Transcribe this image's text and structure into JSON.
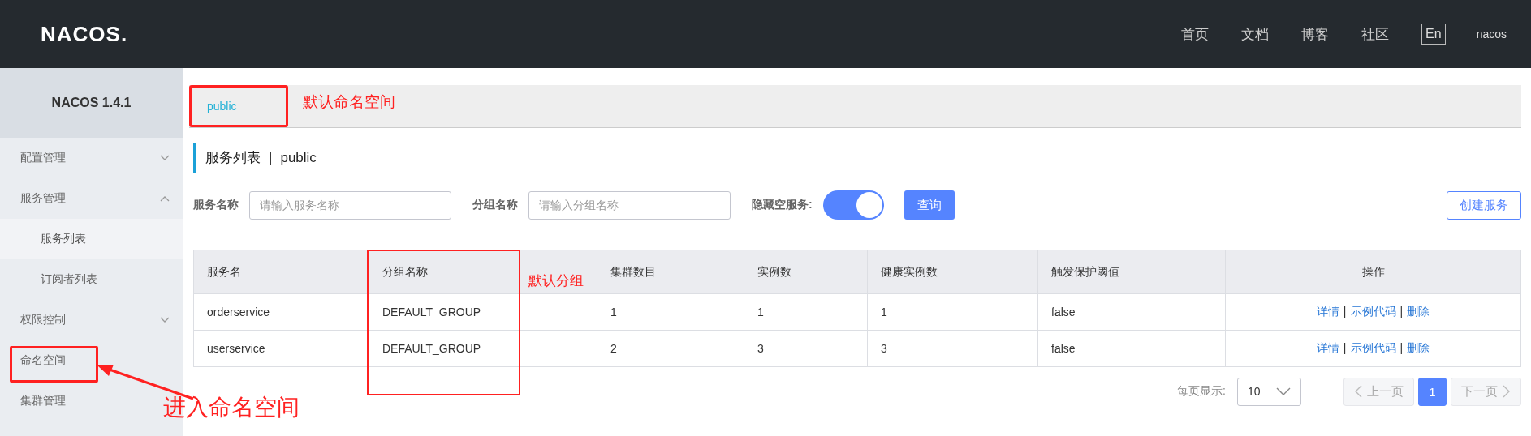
{
  "header": {
    "logo": "NACOS.",
    "nav": [
      "首页",
      "文档",
      "博客",
      "社区"
    ],
    "language": "En",
    "user": "nacos"
  },
  "sidebar": {
    "title": "NACOS 1.4.1",
    "items": [
      {
        "label": "配置管理",
        "kind": "group",
        "expanded": false,
        "selected": false,
        "highlighted": false
      },
      {
        "label": "服务管理",
        "kind": "group",
        "expanded": true,
        "selected": false,
        "highlighted": false,
        "children": [
          {
            "label": "服务列表",
            "selected": true
          },
          {
            "label": "订阅者列表",
            "selected": false
          }
        ]
      },
      {
        "label": "权限控制",
        "kind": "group",
        "expanded": false,
        "selected": false,
        "highlighted": false
      },
      {
        "label": "命名空间",
        "kind": "link",
        "selected": false,
        "highlighted": true
      },
      {
        "label": "集群管理",
        "kind": "link",
        "selected": false,
        "highlighted": false
      }
    ]
  },
  "namespaces": [
    {
      "label": "public",
      "selected": true,
      "highlighted": true
    }
  ],
  "page_title": {
    "title": "服务列表",
    "separator": "|",
    "namespace": "public"
  },
  "filters": [
    {
      "kind": "text",
      "label": "服务名称",
      "placeholder": "请输入服务名称"
    },
    {
      "kind": "text",
      "label": "分组名称",
      "placeholder": "请输入分组名称"
    },
    {
      "kind": "switch",
      "label": "隐藏空服务:",
      "on": true
    }
  ],
  "query_button": "查询",
  "create_button": "创建服务",
  "table": {
    "columns": [
      {
        "label": "服务名",
        "highlighted": false
      },
      {
        "label": "分组名称",
        "highlighted": true
      },
      {
        "label": "集群数目",
        "highlighted": false
      },
      {
        "label": "实例数",
        "highlighted": false
      },
      {
        "label": "健康实例数",
        "highlighted": false
      },
      {
        "label": "触发保护阈值",
        "highlighted": false
      },
      {
        "label": "操作",
        "highlighted": false
      }
    ],
    "rows": [
      {
        "cells": [
          "orderservice",
          "DEFAULT_GROUP",
          "1",
          "1",
          "1",
          "false"
        ],
        "actions": [
          "详情",
          "示例代码",
          "删除"
        ]
      },
      {
        "cells": [
          "userservice",
          "DEFAULT_GROUP",
          "2",
          "3",
          "3",
          "false"
        ],
        "actions": [
          "详情",
          "示例代码",
          "删除"
        ]
      }
    ],
    "action_separator": "|"
  },
  "pagination": {
    "per_page_label": "每页显示:",
    "per_page": "10",
    "prev": {
      "label": "上一页",
      "disabled": true
    },
    "pages": [
      {
        "label": "1",
        "selected": true
      }
    ],
    "next": {
      "label": "下一页",
      "disabled": true
    }
  },
  "annotations": {
    "namespace_note": "默认命名空间",
    "group_note": "默认分组",
    "menu_note": "进入命名空间"
  }
}
